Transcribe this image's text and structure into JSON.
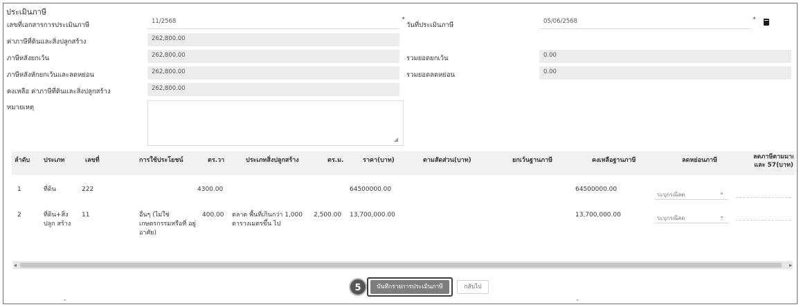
{
  "section_title": "ประเมินภาษี",
  "form": {
    "doc_no_label": "เลขที่เอกสารการประเมินภาษี",
    "doc_no_value": "11/2568",
    "total_tax_label": "ค่าภาษีที่ดินและสิ่งปลูกสร้าง",
    "total_tax_value": "262,800.00",
    "tax_before_exempt_label": "ภาษีหลังยกเว้น",
    "tax_before_exempt_value": "262,800.00",
    "tax_after_reduce_label": "ภาษีหลังหักยกเว้นและลดหย่อน",
    "tax_after_reduce_value": "262,800.00",
    "remaining_label": "คงเหลือ ค่าภาษีที่ดินและสิ่งปลูกสร้าง",
    "remaining_value": "262,800.00",
    "note_label": "หมายเหตุ",
    "assess_date_label": "วันที่ประเมินภาษี",
    "assess_date_value": "05/06/2568",
    "total_exempt_label": "รวมยอดยกเว้น",
    "total_exempt_value": "0.00",
    "total_reduce_label": "รวมยอดลดหย่อน",
    "total_reduce_value": "0.00"
  },
  "table": {
    "headers": {
      "no": "ลำดับ",
      "type": "ประเภท",
      "number": "เลขที่",
      "usage": "การใช้ประโยชน์",
      "sqwa": "ตร.วา",
      "building_type": "ประเภทสิ่งปลูกสร้าง",
      "sqm": "ตร.ม.",
      "price": "ราคา(บาท)",
      "share_price": "ตามสัดส่วน(บาท)",
      "exempt_base": "ยกเว้นฐานภาษี",
      "remaining_base": "คงเหลือฐานภาษี",
      "reduce": "ลดหย่อนภาษี",
      "reduce_law_1": "ลดภาษีตามมาตร",
      "reduce_law_2": "และ 57(บาท)"
    },
    "rows": [
      {
        "no": "1",
        "type": "ที่ดิน",
        "number": "222",
        "usage": "",
        "sqwa": "4300.00",
        "building_type": "",
        "sqm": "",
        "price": "64500000.00",
        "share_price": "",
        "exempt_base": "",
        "remaining_base": "64500000.00",
        "reduce": "ระบุกรณีลด"
      },
      {
        "no": "2",
        "type": "ที่ดิน+สิ่ง ปลูก สร้าง",
        "number": "11",
        "usage": "อื่นๆ (ไม่ใช่ เกษตรกรรมหรือที่ อยู่อาศัย)",
        "sqwa": "400.00",
        "building_type": "ตลาด พื้นที่เกินกว่า 1,000 ตารางเมตรขึ้น ไป",
        "sqm": "2,500.00",
        "price": "13,700,000.00",
        "share_price": "",
        "exempt_base": "",
        "remaining_base": "13,700,000.00",
        "reduce": "ระบุกรณีลด"
      }
    ]
  },
  "buttons": {
    "step_number": "5",
    "save_label": "บันทึกรายการประเมินภาษี",
    "back_label": "กลับไป"
  },
  "scrollbar": {
    "left_arrow": "◂",
    "right_arrow": "▸"
  },
  "icons": {
    "calendar": "calendar-icon",
    "select_chevron": "⌄"
  }
}
